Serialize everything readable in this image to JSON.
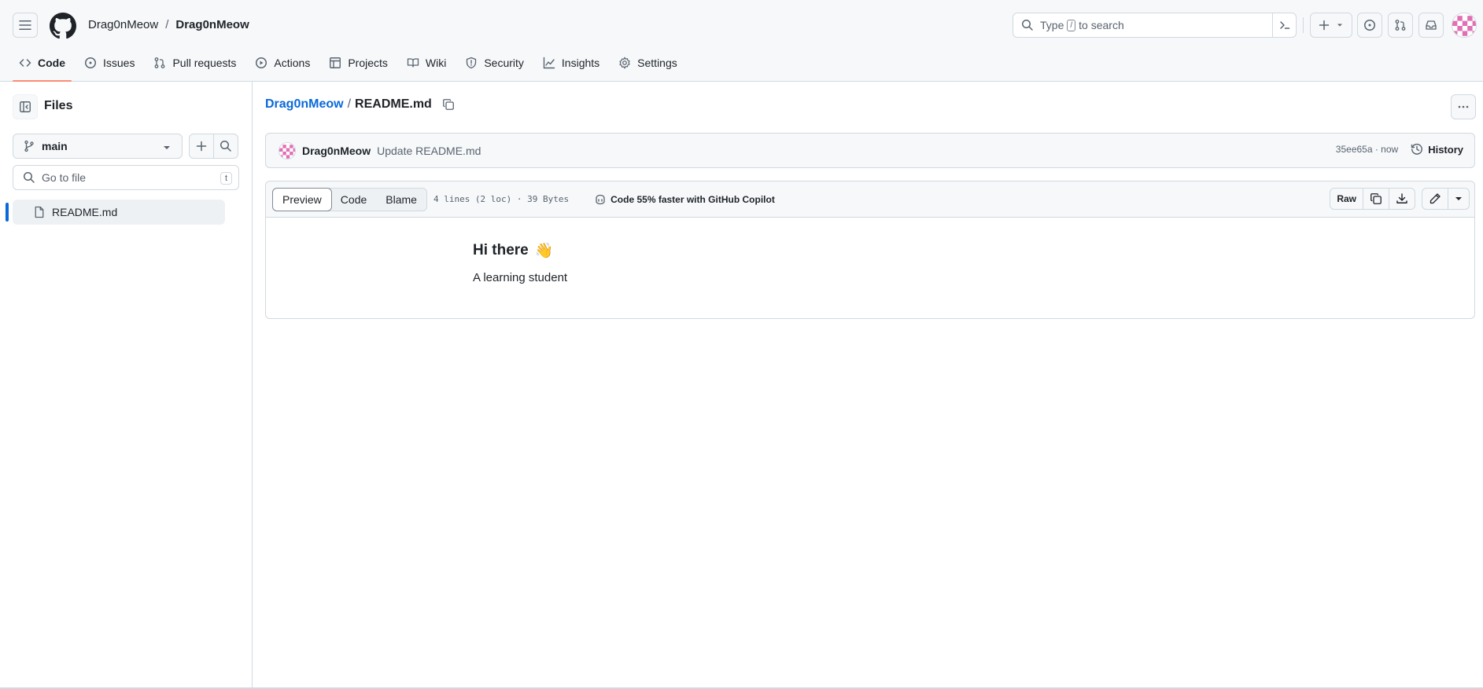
{
  "header": {
    "owner": "Drag0nMeow",
    "separator": "/",
    "repo": "Drag0nMeow",
    "search_prefix": "Type",
    "search_key": "/",
    "search_suffix": "to search"
  },
  "tabs": [
    {
      "label": "Code",
      "icon": "code-icon",
      "selected": true
    },
    {
      "label": "Issues",
      "icon": "issue-opened-icon"
    },
    {
      "label": "Pull requests",
      "icon": "git-pull-request-icon"
    },
    {
      "label": "Actions",
      "icon": "play-icon"
    },
    {
      "label": "Projects",
      "icon": "table-icon"
    },
    {
      "label": "Wiki",
      "icon": "book-icon"
    },
    {
      "label": "Security",
      "icon": "shield-icon"
    },
    {
      "label": "Insights",
      "icon": "graph-icon"
    },
    {
      "label": "Settings",
      "icon": "gear-icon"
    }
  ],
  "sidebar": {
    "title": "Files",
    "branch": "main",
    "goto_placeholder": "Go to file",
    "goto_key": "t",
    "files": [
      {
        "name": "README.md",
        "selected": true
      }
    ]
  },
  "path": {
    "repo_link": "Drag0nMeow",
    "separator": "/",
    "file": "README.md"
  },
  "commit": {
    "author": "Drag0nMeow",
    "message": "Update README.md",
    "sha_time": "35ee65a · now",
    "history_label": "History"
  },
  "file_header": {
    "view_options": [
      "Preview",
      "Code",
      "Blame"
    ],
    "active_view": "Preview",
    "stats": "4 lines (2 loc) · 39 Bytes",
    "copilot": "Code 55% faster with GitHub Copilot",
    "raw_label": "Raw"
  },
  "readme": {
    "heading": "Hi there",
    "emoji": "👋",
    "body": "A learning student"
  },
  "colors": {
    "accent_link": "#0969da",
    "tab_underline": "#fd8c73",
    "avatar_pink": "#e06fb3"
  }
}
